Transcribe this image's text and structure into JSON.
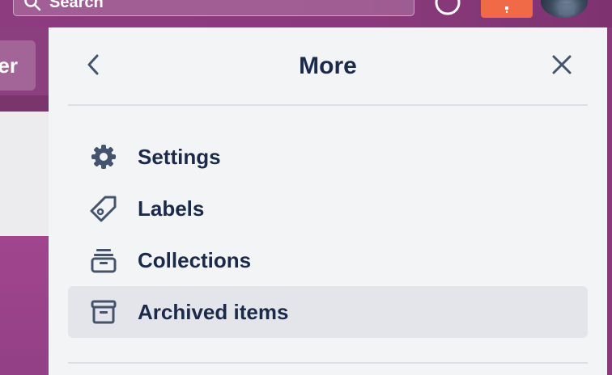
{
  "header": {
    "search_label": "Search",
    "icons": {
      "search": "search-icon",
      "help": "help-circle-icon",
      "notifications": "bell-icon",
      "avatar": "user-avatar"
    },
    "accent_color": "#f06a48",
    "board_color": "#8c3f7e"
  },
  "board": {
    "partial_button_label": "er"
  },
  "panel": {
    "title": "More",
    "back_icon": "chevron-left-icon",
    "close_icon": "close-icon",
    "items": [
      {
        "label": "Settings",
        "icon": "gear-icon",
        "active": false
      },
      {
        "label": "Labels",
        "icon": "tag-icon",
        "active": false
      },
      {
        "label": "Collections",
        "icon": "collection-icon",
        "active": false
      },
      {
        "label": "Archived items",
        "icon": "archive-icon",
        "active": true
      }
    ],
    "text_color": "#1b2a4a",
    "active_bg": "#e4e5ea"
  }
}
